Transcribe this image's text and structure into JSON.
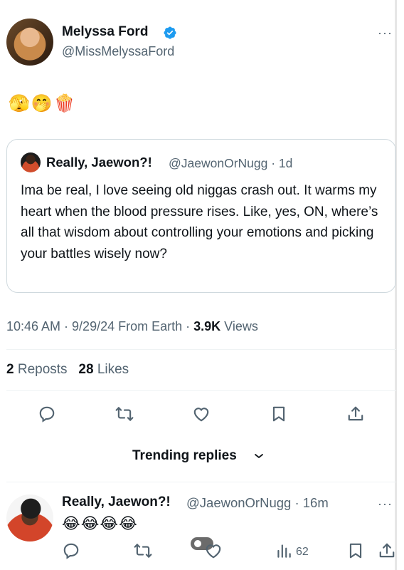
{
  "tweet": {
    "author_name": "Melyssa Ford",
    "author_handle": "@MissMelyssaFord",
    "text_emojis": "🫣🤭🍿",
    "timestamp": "10:46 AM · 9/29/24 From Earth · ",
    "views_count": "3.9K",
    "views_label": " Views",
    "reposts_count": "2",
    "reposts_label": " Reposts",
    "likes_count": "28",
    "likes_label": " Likes",
    "more_glyph": "···"
  },
  "quote": {
    "author_name": "Really, Jaewon?!",
    "author_handle": "@JaewonOrNugg · 1d",
    "text": "Ima be real, I love seeing old niggas crash out. It warms my heart when the blood pressure rises. Like, yes, ON, where’s all that wisdom about controlling your emotions and picking your battles wisely now?"
  },
  "actions": [
    "reply-icon",
    "repost-icon",
    "like-icon",
    "bookmark-icon",
    "share-icon"
  ],
  "trending": {
    "label": "Trending replies"
  },
  "reply": {
    "author_name": "Really, Jaewon?!",
    "author_handle": "@JaewonOrNugg · 16m",
    "text_emojis": "😂😂😂😂",
    "views": "62",
    "more_glyph": "···"
  },
  "colors": {
    "text_primary": "#0f1419",
    "text_secondary": "#536471",
    "verified_blue": "#1d9bf0",
    "border": "#cfd9de"
  }
}
